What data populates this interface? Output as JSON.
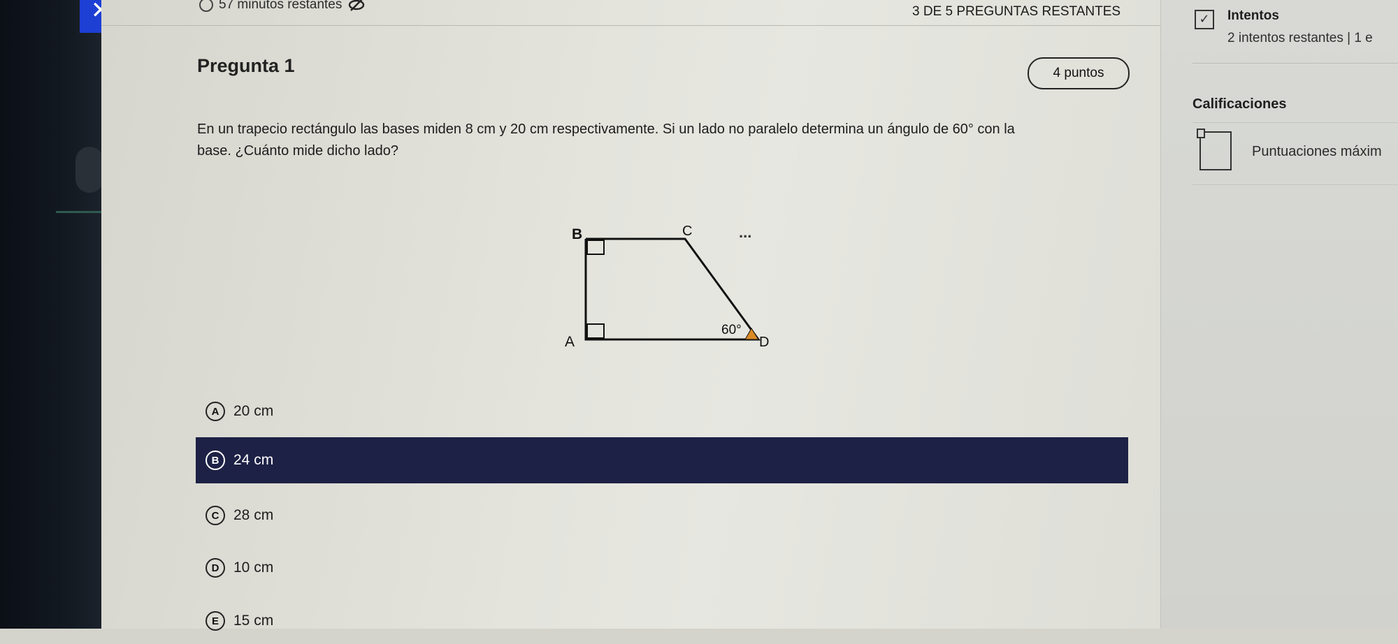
{
  "header": {
    "close_icon": "close-icon",
    "timer_text": "57 minutos restantes",
    "timer_hide_icon": "eye-off-icon",
    "questions_remaining": "3 DE 5 PREGUNTAS RESTANTES"
  },
  "question": {
    "title": "Pregunta 1",
    "points": "4 puntos",
    "text_line1": "En un trapecio rectángulo las bases miden 8 cm y 20 cm respectivamente. Si un lado no paralelo determina un ángulo de 60° con la",
    "text_line2": "base. ¿Cuánto mide dicho lado?"
  },
  "figure": {
    "labels": {
      "A": "A",
      "B": "B",
      "C": "C",
      "D": "D"
    },
    "angle": "60°",
    "more": "..."
  },
  "options": [
    {
      "letter": "A",
      "text": "20 cm",
      "selected": false
    },
    {
      "letter": "B",
      "text": "24 cm",
      "selected": true
    },
    {
      "letter": "C",
      "text": "28 cm",
      "selected": false
    },
    {
      "letter": "D",
      "text": "10 cm",
      "selected": false
    },
    {
      "letter": "E",
      "text": "15 cm",
      "selected": false
    }
  ],
  "sidebar": {
    "attempts_title": "Intentos",
    "attempts_sub": "2 intentos restantes | 1 e",
    "grades_title": "Calificaciones",
    "max_scores": "Puntuaciones máxim"
  },
  "colors": {
    "selected_bg": "#1d2145",
    "close_bg": "#1d3fd3",
    "angle_marker": "#d98a24"
  }
}
